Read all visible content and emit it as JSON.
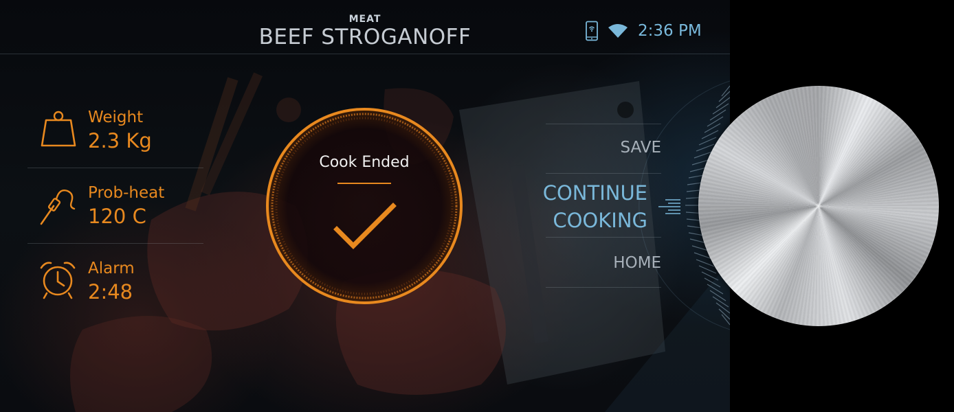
{
  "header": {
    "category": "MEAT",
    "title": "BEEF STROGANOFF",
    "time": "2:36 PM"
  },
  "icons": {
    "phone": "phone-remote-icon",
    "wifi": "wifi-icon",
    "weight": "weight-icon",
    "probe": "probe-icon",
    "alarm": "alarm-clock-icon",
    "check": "check-icon"
  },
  "stats": {
    "weight": {
      "label": "Weight",
      "value": "2.3 Kg"
    },
    "probe": {
      "label": "Prob-heat",
      "value": "120 C"
    },
    "alarm": {
      "label": "Alarm",
      "value": "2:48"
    }
  },
  "center": {
    "status": "Cook Ended"
  },
  "menu": {
    "save": "SAVE",
    "continue_line1": "CONTINUE",
    "continue_line2": "COOKING",
    "home": "HOME"
  },
  "colors": {
    "accent": "#e8891f",
    "highlight": "#7ab8da",
    "text_muted": "#a7b0b9"
  }
}
